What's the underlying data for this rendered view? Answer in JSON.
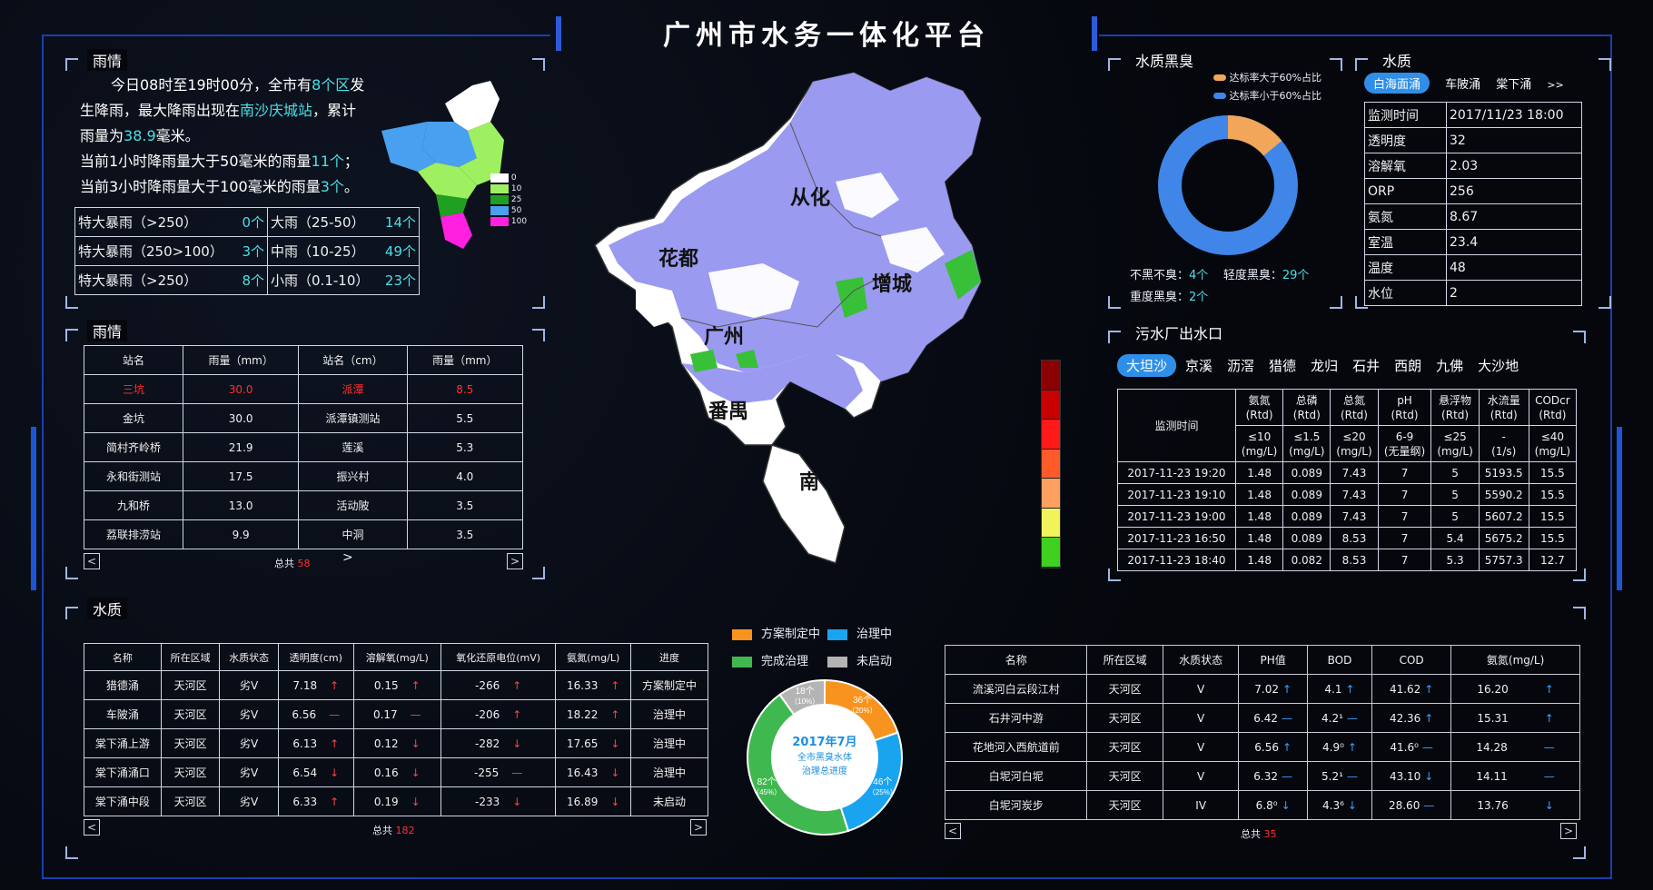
{
  "header": {
    "title": "广州市水务一体化平台"
  },
  "rain_summary": {
    "title": "雨情",
    "line1_a": "今日08时至19时00分，全市有",
    "line1_b": "8个区",
    "line1_c": "发",
    "line2_a": "生降雨，最大降雨出现在",
    "line2_b": "南沙庆城站",
    "line2_c": "，累计",
    "line3_a": "雨量为",
    "line3_b": "38.9",
    "line3_c": "毫米。",
    "line4_a": "当前1小时降雨量大于50毫米的雨量",
    "line4_b": "11个",
    "line4_c": "；",
    "line5_a": "当前3小时降雨量大于100毫米的雨量",
    "line5_b": "3个",
    "line5_c": "。",
    "legend": [
      "0",
      "10",
      "25",
      "50",
      "100"
    ],
    "levels": [
      {
        "l": "特大暴雨（>250）",
        "lv": "0个",
        "r": "大雨（25-50）",
        "rv": "14个"
      },
      {
        "l": "特大暴雨（250>100）",
        "lv": "3个",
        "r": "中雨（10-25）",
        "rv": "49个"
      },
      {
        "l": "特大暴雨（>250）",
        "lv": "8个",
        "r": "小雨（0.1-10）",
        "rv": "23个"
      }
    ]
  },
  "rain_table": {
    "title": "雨情",
    "headers": [
      "站名",
      "雨量（mm）",
      "站名（cm）",
      "雨量（mm）"
    ],
    "rows": [
      [
        "三坑",
        "30.0",
        "派潭",
        "8.5"
      ],
      [
        "金坑",
        "30.0",
        "派潭镇测站",
        "5.5"
      ],
      [
        "简村齐岭桥",
        "21.9",
        "莲溪",
        "5.3"
      ],
      [
        "永和街测站",
        "17.5",
        "振兴村",
        "4.0"
      ],
      [
        "九和桥",
        "13.0",
        "活动陂",
        "3.5"
      ],
      [
        "荔联排涝站",
        "9.9",
        "中洞",
        "3.5"
      ]
    ],
    "total_label": "总共",
    "total": "58"
  },
  "map": {
    "labels": [
      "从化",
      "花都",
      "增城",
      "广州",
      "番禺",
      "南"
    ]
  },
  "blackodor": {
    "title": "水质黑臭",
    "legend1": "达标率大于60%占比",
    "legend2": "达标率小于60%占比",
    "color1": "#f2a65a",
    "color2": "#3f86e8",
    "pct_above": 14,
    "stat1": "不黑不臭：",
    "stat1v": "4个",
    "stat2": "轻度黑臭：",
    "stat2v": "29个",
    "stat3": "重度黑臭：",
    "stat3v": "2个"
  },
  "quality_box": {
    "title": "水质",
    "tabs": [
      "白海面涌",
      "车陂涌",
      "棠下涌"
    ],
    "more": ">>",
    "rows": [
      [
        "监测时间",
        "2017/11/23 18:00"
      ],
      [
        "透明度",
        "32"
      ],
      [
        "溶解氧",
        "2.03"
      ],
      [
        "ORP",
        "256"
      ],
      [
        "氨氮",
        "8.67"
      ],
      [
        "室温",
        "23.4"
      ],
      [
        "温度",
        "48"
      ],
      [
        "水位",
        "2"
      ]
    ]
  },
  "outfall": {
    "title": "污水厂出水口",
    "tabs": [
      "大坦沙",
      "京溪",
      "沥滘",
      "猎德",
      "龙归",
      "石井",
      "西朗",
      "九佛",
      "大沙地"
    ],
    "time_header": "监测时间",
    "cols": [
      [
        "氨氮",
        "(Rtd)",
        "≤10",
        "(mg/L)"
      ],
      [
        "总磷",
        "(Rtd)",
        "≤1.5",
        "(mg/L)"
      ],
      [
        "总氮",
        "(Rtd)",
        "≤20",
        "(mg/L)"
      ],
      [
        "pH",
        "(Rtd)",
        "6-9",
        "(无量纲)"
      ],
      [
        "悬浮物",
        "(Rtd)",
        "≤25",
        "(mg/L)"
      ],
      [
        "水流量",
        "(Rtd)",
        "-",
        "(1/s)"
      ],
      [
        "CODcr",
        "(Rtd)",
        "≤40",
        "(mg/L)"
      ]
    ],
    "rows": [
      [
        "2017-11-23 19:20",
        "1.48",
        "0.089",
        "7.43",
        "7",
        "5",
        "5193.5",
        "15.5"
      ],
      [
        "2017-11-23 19:10",
        "1.48",
        "0.089",
        "7.43",
        "7",
        "5",
        "5590.2",
        "15.5"
      ],
      [
        "2017-11-23 19:00",
        "1.48",
        "0.089",
        "7.43",
        "7",
        "5",
        "5607.2",
        "15.5"
      ],
      [
        "2017-11-23 16:50",
        "1.48",
        "0.089",
        "8.53",
        "7",
        "5.4",
        "5675.2",
        "15.5"
      ],
      [
        "2017-11-23 18:40",
        "1.48",
        "0.082",
        "8.53",
        "7",
        "5.3",
        "5757.3",
        "12.7"
      ]
    ]
  },
  "bottom_left": {
    "title": "水质",
    "headers": [
      "名称",
      "所在区域",
      "水质状态",
      "透明度(cm)",
      "溶解氧(mg/L)",
      "氧化还原电位(mV)",
      "氨氮(mg/L)",
      "进度"
    ],
    "rows": [
      [
        "猎德涌",
        "天河区",
        "劣V",
        "7.18",
        "↑",
        "0.15",
        "↑",
        "-266",
        "↑",
        "16.33",
        "↑",
        "方案制定中"
      ],
      [
        "车陂涌",
        "天河区",
        "劣V",
        "6.56",
        "—",
        "0.17",
        "—",
        "-206",
        "↑",
        "18.22",
        "↑",
        "治理中"
      ],
      [
        "棠下涌上游",
        "天河区",
        "劣V",
        "6.13",
        "↑",
        "0.12",
        "↓",
        "-282",
        "↓",
        "17.65",
        "↓",
        "治理中"
      ],
      [
        "棠下涌涌口",
        "天河区",
        "劣V",
        "6.54",
        "↓",
        "0.16",
        "↓",
        "-255",
        "—",
        "16.43",
        "↓",
        "治理中"
      ],
      [
        "棠下涌中段",
        "天河区",
        "劣V",
        "6.33",
        "↑",
        "0.19",
        "↓",
        "-233",
        "↓",
        "16.89",
        "↓",
        "未启动"
      ]
    ],
    "total_label": "总共",
    "total": "182"
  },
  "progress": {
    "legend": [
      {
        "label": "方案制定中",
        "color": "#f7931e"
      },
      {
        "label": "治理中",
        "color": "#1aa3ef"
      },
      {
        "label": "完成治理",
        "color": "#3fb94f"
      },
      {
        "label": "未启动",
        "color": "#b4b4b4"
      }
    ],
    "center1": "2017年7月",
    "center2": "全市黑臭水体",
    "center3": "治理总进度",
    "slices": [
      {
        "label": "36个",
        "pct": "（20%）",
        "value": 36,
        "color": "#f7931e"
      },
      {
        "label": "46个",
        "pct": "（25%）",
        "value": 46,
        "color": "#1aa3ef"
      },
      {
        "label": "82个",
        "pct": "（45%）",
        "value": 82,
        "color": "#3fb94f"
      },
      {
        "label": "18个",
        "pct": "（10%）",
        "value": 18,
        "color": "#b4b4b4"
      }
    ]
  },
  "bottom_right": {
    "headers": [
      "名称",
      "所在区域",
      "水质状态",
      "PH值",
      "BOD",
      "COD",
      "氨氮(mg/L)"
    ],
    "rows": [
      [
        "流溪河白云段江村",
        "天河区",
        "V",
        "7.02",
        "↑",
        "4.1",
        "↑",
        "41.62",
        "↑",
        "16.20",
        "↑"
      ],
      [
        "石井河中游",
        "天河区",
        "V",
        "6.42",
        "—",
        "4.2¹",
        "—",
        "42.36",
        "↑",
        "15.31",
        "↑"
      ],
      [
        "花地河入西航道前",
        "天河区",
        "V",
        "6.56",
        "↑",
        "4.9⁰",
        "↑",
        "41.6⁰",
        "—",
        "14.28",
        "—"
      ],
      [
        "白坭河白坭",
        "天河区",
        "V",
        "6.32",
        "—",
        "5.2¹",
        "—",
        "43.10",
        "↓",
        "14.11",
        "—"
      ],
      [
        "白坭河炭步",
        "天河区",
        "IV",
        "6.8⁰",
        "↓",
        "4.3⁶",
        "↓",
        "28.60",
        "—",
        "13.76",
        "↓"
      ]
    ],
    "total_label": "总共",
    "total": "35"
  },
  "colorbar": [
    "#8b0000",
    "#c80000",
    "#ff1a1a",
    "#ff5a2a",
    "#ffa060",
    "#f2f25a",
    "#40d020"
  ]
}
